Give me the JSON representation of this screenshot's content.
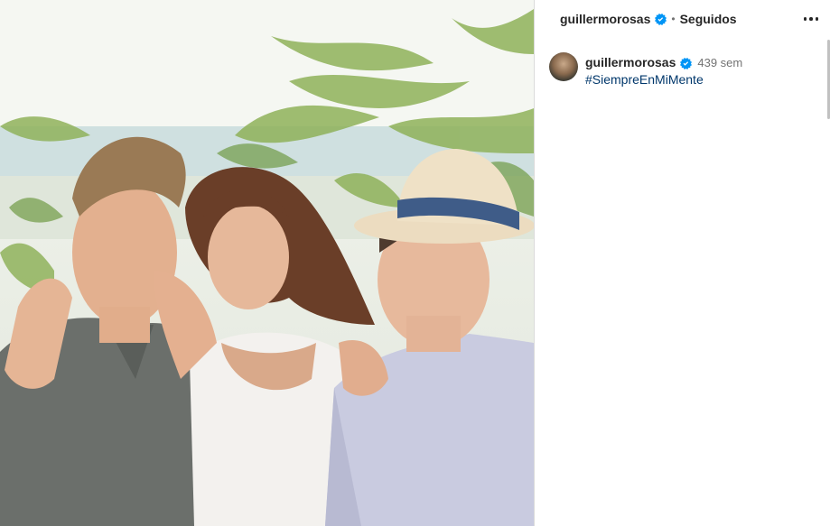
{
  "photo": {
    "alt": ""
  },
  "header": {
    "username": "guillermorosas",
    "separator": "•",
    "follow_status": "Seguidos"
  },
  "caption": {
    "username": "guillermorosas",
    "time": "439 sem",
    "hashtag": "#SiempreEnMiMente"
  },
  "colors": {
    "verified_blue": "#0095f6",
    "link_blue": "#00376b",
    "muted": "#737373"
  }
}
